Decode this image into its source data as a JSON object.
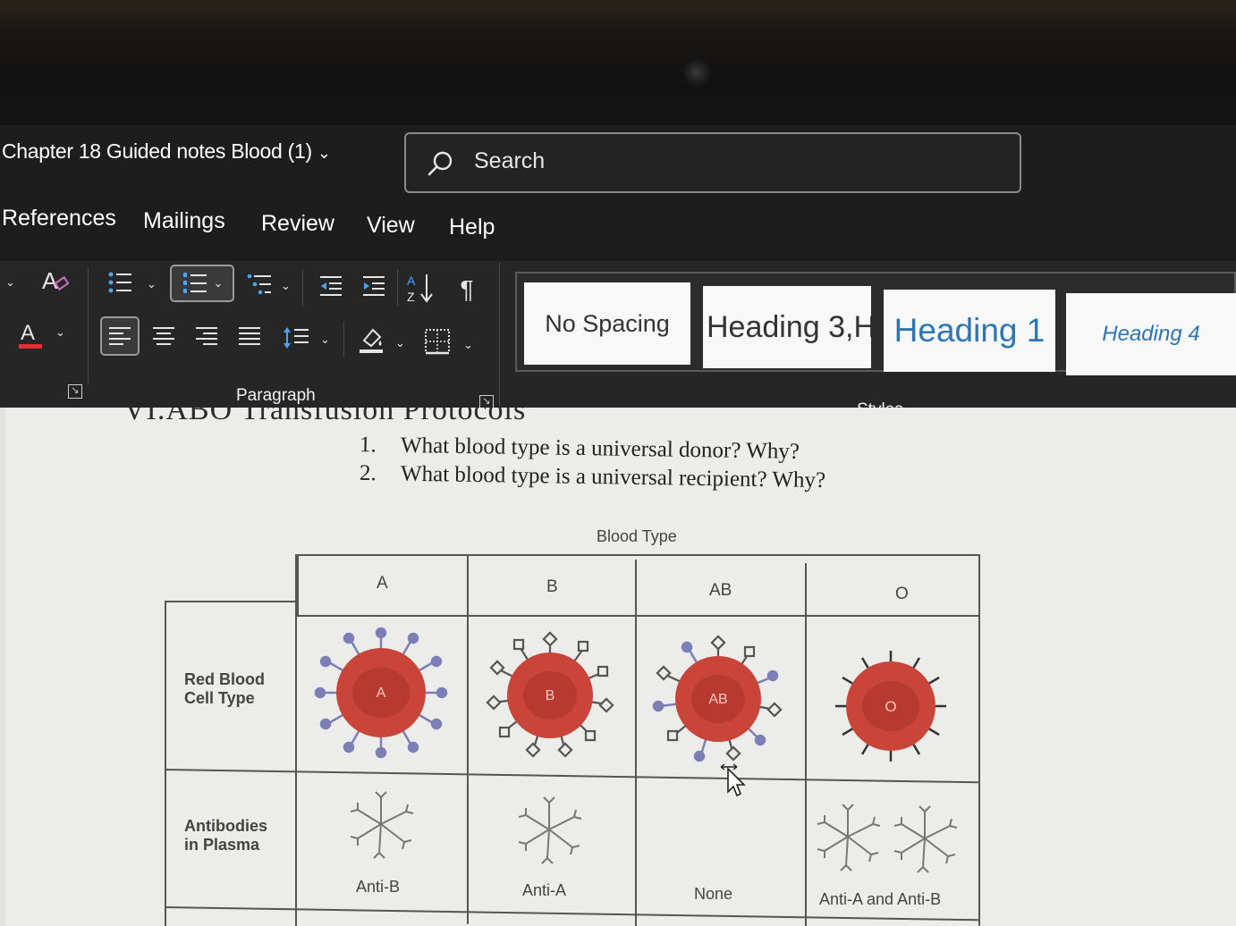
{
  "window": {
    "doc_title": "Chapter 18 Guided notes  Blood (1)",
    "title_chevron_icon": "chevron-down-icon"
  },
  "search": {
    "placeholder": "Search",
    "icon": "search-icon"
  },
  "menu": {
    "items": [
      "References",
      "Mailings",
      "Review",
      "View",
      "Help"
    ]
  },
  "ribbon": {
    "paragraph_group_label": "Paragraph",
    "styles_group_label": "Styles",
    "styles": [
      "No Spacing",
      "Heading 3,H",
      "Heading 1",
      "Heading 4"
    ],
    "font_color_letter": "A",
    "colors": {
      "font_color_bar": "#e03030",
      "heading_blue": "#2e75b6"
    },
    "icons": [
      "clear-formatting-icon",
      "font-color-icon",
      "bullets-icon",
      "numbering-icon",
      "multilevel-list-icon",
      "decrease-indent-icon",
      "increase-indent-icon",
      "sort-icon",
      "show-marks-icon",
      "align-left-icon",
      "center-icon",
      "align-right-icon",
      "justify-icon",
      "line-spacing-icon",
      "shading-icon",
      "borders-icon"
    ]
  },
  "document": {
    "heading_partial": "VI.ABO Transfusion Protocols",
    "questions": [
      {
        "num": "1.",
        "text": "What blood type is a universal donor? Why?"
      },
      {
        "num": "2.",
        "text": "What blood type is a universal recipient? Why?"
      }
    ],
    "figure": {
      "caption": "Blood Type",
      "columns": [
        "A",
        "B",
        "AB",
        "O"
      ],
      "row_labels": [
        "Red Blood Cell Type",
        "Antibodies in Plasma"
      ],
      "cell_labels": [
        "A",
        "B",
        "AB",
        "O"
      ],
      "antibodies": [
        "Anti-B",
        "Anti-A",
        "None",
        "Anti-A and Anti-B"
      ],
      "colors": {
        "cell_red": "#c9453a",
        "antigen_a": "#7b7fb5",
        "antigen_b": "#555555"
      }
    }
  }
}
